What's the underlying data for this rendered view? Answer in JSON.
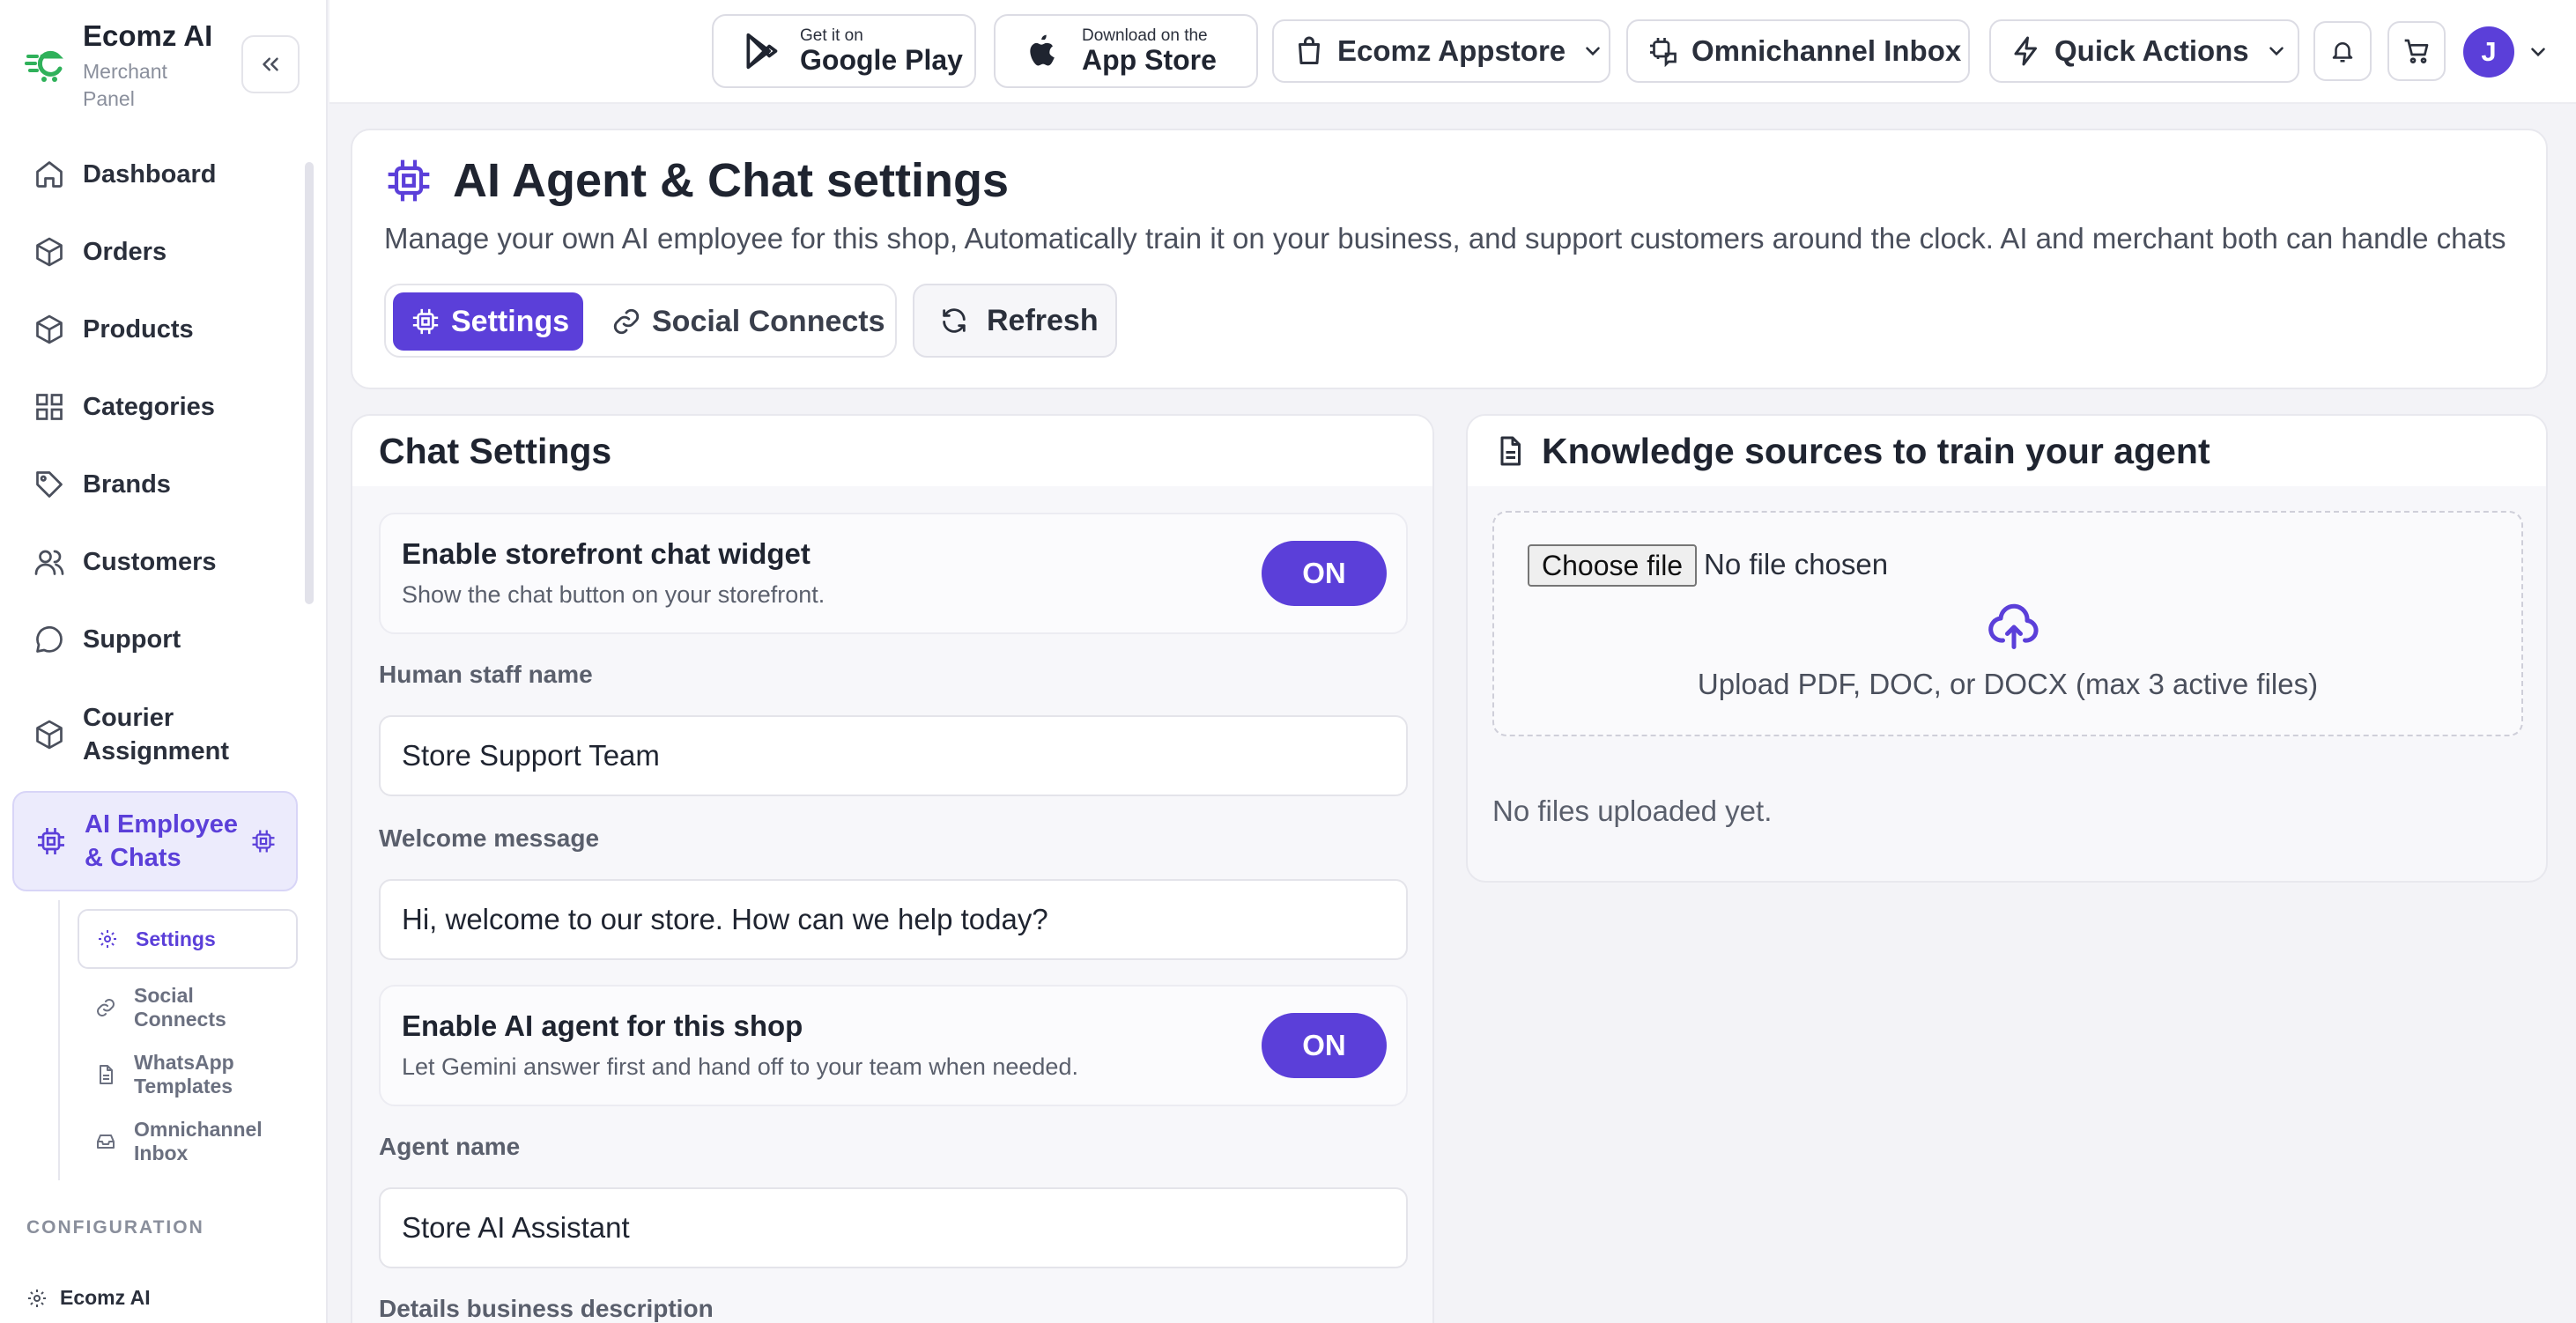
{
  "brand": {
    "name": "Ecomz AI",
    "subtitle": "Merchant Panel"
  },
  "sidebar": {
    "items": [
      {
        "label": "Dashboard",
        "icon": "home-icon"
      },
      {
        "label": "Orders",
        "icon": "box-icon"
      },
      {
        "label": "Products",
        "icon": "box-icon"
      },
      {
        "label": "Categories",
        "icon": "grid-icon"
      },
      {
        "label": "Brands",
        "icon": "tag-icon"
      },
      {
        "label": "Customers",
        "icon": "users-icon"
      },
      {
        "label": "Support",
        "icon": "chat-bubble-icon"
      },
      {
        "label": "Courier Assignment",
        "icon": "box-icon"
      },
      {
        "label": "AI Employee & Chats",
        "icon": "chip-icon",
        "active": true
      }
    ],
    "subitems": [
      {
        "label": "Settings",
        "icon": "gear-icon",
        "active": true
      },
      {
        "label": "Social Connects",
        "icon": "link-icon"
      },
      {
        "label": "WhatsApp Templates",
        "icon": "document-icon"
      },
      {
        "label": "Omnichannel Inbox",
        "icon": "inbox-icon"
      }
    ],
    "section_label": "CONFIGURATION",
    "config_item": {
      "label": "Ecomz AI",
      "icon": "gear-icon"
    }
  },
  "topbar": {
    "google_play": {
      "small": "Get it on",
      "big": "Google Play"
    },
    "app_store": {
      "small": "Download on the",
      "big": "App Store"
    },
    "appstore_btn": "Ecomz Appstore",
    "omnichannel_btn": "Omnichannel Inbox",
    "quick_actions_btn": "Quick Actions",
    "avatar_initial": "J"
  },
  "header": {
    "title": "AI Agent & Chat settings",
    "description": "Manage your own AI employee for this shop, Automatically train it on your business, and support customers around the clock. AI and merchant both can handle chats",
    "tabs": [
      {
        "label": "Settings",
        "active": true
      },
      {
        "label": "Social Connects",
        "active": false
      }
    ],
    "refresh_label": "Refresh"
  },
  "chat_settings": {
    "title": "Chat Settings",
    "widget_toggle": {
      "title": "Enable storefront chat widget",
      "subtitle": "Show the chat button on your storefront.",
      "state": "ON"
    },
    "staff_name": {
      "label": "Human staff name",
      "value": "Store Support Team"
    },
    "welcome": {
      "label": "Welcome message",
      "value": "Hi, welcome to our store. How can we help today?"
    },
    "agent_toggle": {
      "title": "Enable AI agent for this shop",
      "subtitle": "Let Gemini answer first and hand off to your team when needed.",
      "state": "ON"
    },
    "agent_name": {
      "label": "Agent name",
      "value": "Store AI Assistant"
    },
    "business_desc": {
      "label": "Details business description"
    }
  },
  "knowledge": {
    "title": "Knowledge sources to train your agent",
    "choose_file": "Choose file",
    "no_file": "No file chosen",
    "upload_hint": "Upload PDF, DOC, or DOCX (max 3 active files)",
    "empty": "No files uploaded yet."
  },
  "colors": {
    "accent": "#5b3fd9",
    "brand_green": "#2fb15a"
  }
}
